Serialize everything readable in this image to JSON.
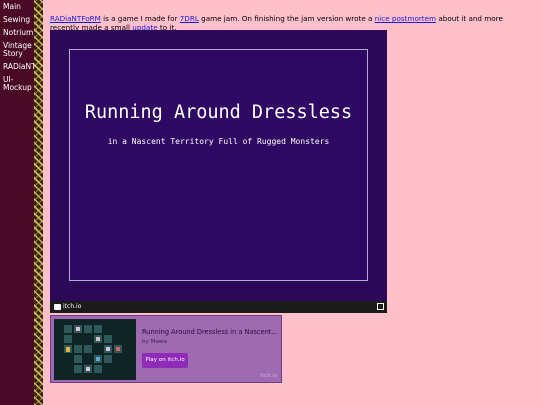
{
  "sidebar": {
    "items": [
      {
        "label": "Main"
      },
      {
        "label": "Sewing"
      },
      {
        "label": "Notrium"
      },
      {
        "label": "Vintage Story"
      },
      {
        "label": "RADiaNT"
      },
      {
        "label": "UI-Mockup"
      }
    ]
  },
  "intro": {
    "link_game": "RADiaNTFoRM",
    "text1": " is a game I made for ",
    "link_jam": "7DRL",
    "text2": " game jam. On finishing the jam version wrote a ",
    "link_postmortem": "nice postmortem",
    "text3": " about it and more recently made a small ",
    "link_update": "update",
    "text4": " to it."
  },
  "game": {
    "title": "Running Around Dressless",
    "subtitle": "in a Nascent Territory Full of Rugged Monsters",
    "bar_label": "itch.io"
  },
  "embed": {
    "title": "Running Around Dressless in a Nascent Terri…",
    "author": "by Mawa",
    "play_label": "Play on itch.io",
    "itch_label": "itch.io"
  },
  "colors": {
    "page_bg": "#ffc0cb",
    "sidebar_bg": "#4a0a26",
    "game_bg": "#2c0858",
    "embed_bg": "#9e6ab2",
    "play_button": "#8e2bb8"
  }
}
